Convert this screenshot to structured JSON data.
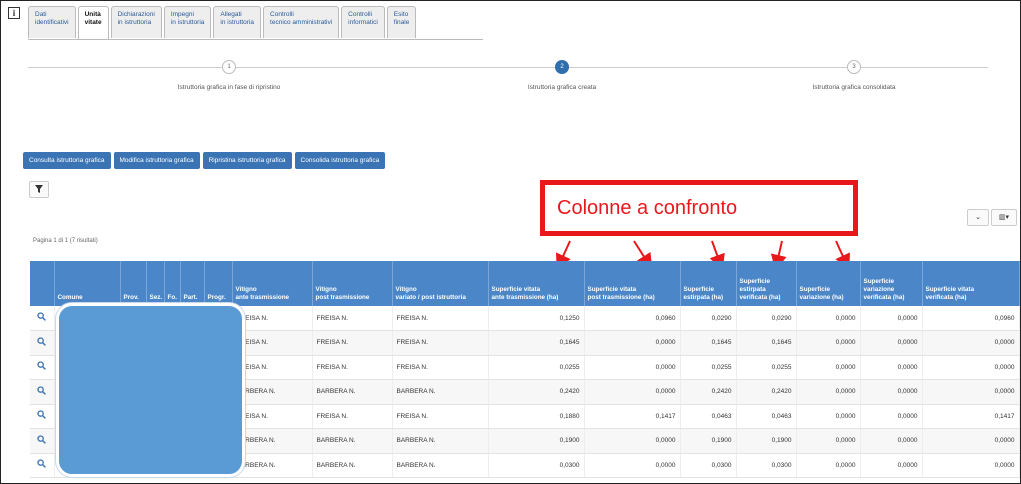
{
  "tabs": [
    {
      "label": "Dati\nidentificativi",
      "active": false
    },
    {
      "label": "Unità\nvitate",
      "active": true
    },
    {
      "label": "Dichiarazioni\nin istruttoria",
      "active": false
    },
    {
      "label": "Impegni\nin istruttoria",
      "active": false
    },
    {
      "label": "Allegati\nin istruttoria",
      "active": false
    },
    {
      "label": "Controlli\ntecnico amministrativi",
      "active": false
    },
    {
      "label": "Controlli\ninformatici",
      "active": false
    },
    {
      "label": "Esito\nfinale",
      "active": false
    }
  ],
  "info_icon": "i",
  "steps": [
    {
      "num": "1",
      "label": "Istruttoria grafica in fase di ripristino",
      "active": false
    },
    {
      "num": "2",
      "label": "Istruttoria grafica creata",
      "active": true
    },
    {
      "num": "3",
      "label": "Istruttoria grafica consolidata",
      "active": false
    }
  ],
  "actions": [
    "Consulta istruttoria grafica",
    "Modifica istruttoria grafica",
    "Ripristina istruttoria grafica",
    "Consolida istruttoria grafica"
  ],
  "filter_icon": "filter-icon",
  "toolbar": {
    "expand": "⌄",
    "columns": "▥▾"
  },
  "callout": "Colonne a confronto",
  "page_info": "Pagina 1 di 1 (7 risultati)",
  "columns": [
    "",
    "Comune",
    "Prov.",
    "Sez.",
    "Fo.",
    "Part.",
    "Progr.",
    "Vitigno\nante trasmissione",
    "Vitigno\npost trasmissione",
    "Vitigno\nvariato / post istruttoria",
    "Superficie vitata\nante trasmissione (ha)",
    "Superficie vitata\npost trasmissione (ha)",
    "Superficie\nestirpata (ha)",
    "Superficie\nestirpata\nverificata (ha)",
    "Superficie\nvariazione (ha)",
    "Superficie\nvariazione\nverificata (ha)",
    "Superficie vitata\nverificata (ha)"
  ],
  "rows": [
    [
      "FREISA N.",
      "FREISA N.",
      "FREISA N.",
      "0,1250",
      "0,0960",
      "0,0290",
      "0,0290",
      "0,0000",
      "0,0000",
      "0,0960"
    ],
    [
      "FREISA N.",
      "FREISA N.",
      "FREISA N.",
      "0,1645",
      "0,0000",
      "0,1645",
      "0,1645",
      "0,0000",
      "0,0000",
      "0,0000"
    ],
    [
      "FREISA N.",
      "FREISA N.",
      "FREISA N.",
      "0,0255",
      "0,0000",
      "0,0255",
      "0,0255",
      "0,0000",
      "0,0000",
      "0,0000"
    ],
    [
      "BARBERA N.",
      "BARBERA N.",
      "BARBERA N.",
      "0,2420",
      "0,0000",
      "0,2420",
      "0,2420",
      "0,0000",
      "0,0000",
      "0,0000"
    ],
    [
      "FREISA N.",
      "FREISA N.",
      "FREISA N.",
      "0,1880",
      "0,1417",
      "0,0463",
      "0,0463",
      "0,0000",
      "0,0000",
      "0,1417"
    ],
    [
      "BARBERA N.",
      "BARBERA N.",
      "BARBERA N.",
      "0,1900",
      "0,0000",
      "0,1900",
      "0,1900",
      "0,0000",
      "0,0000",
      "0,0000"
    ],
    [
      "BARBERA N.",
      "BARBERA N.",
      "BARBERA N.",
      "0,0300",
      "0,0000",
      "0,0300",
      "0,0300",
      "0,0000",
      "0,0000",
      "0,0000"
    ]
  ],
  "colors": {
    "accent": "#3a74b5",
    "header": "#4a86c8",
    "callout": "#e8181c",
    "mask": "#5b9bd5"
  }
}
